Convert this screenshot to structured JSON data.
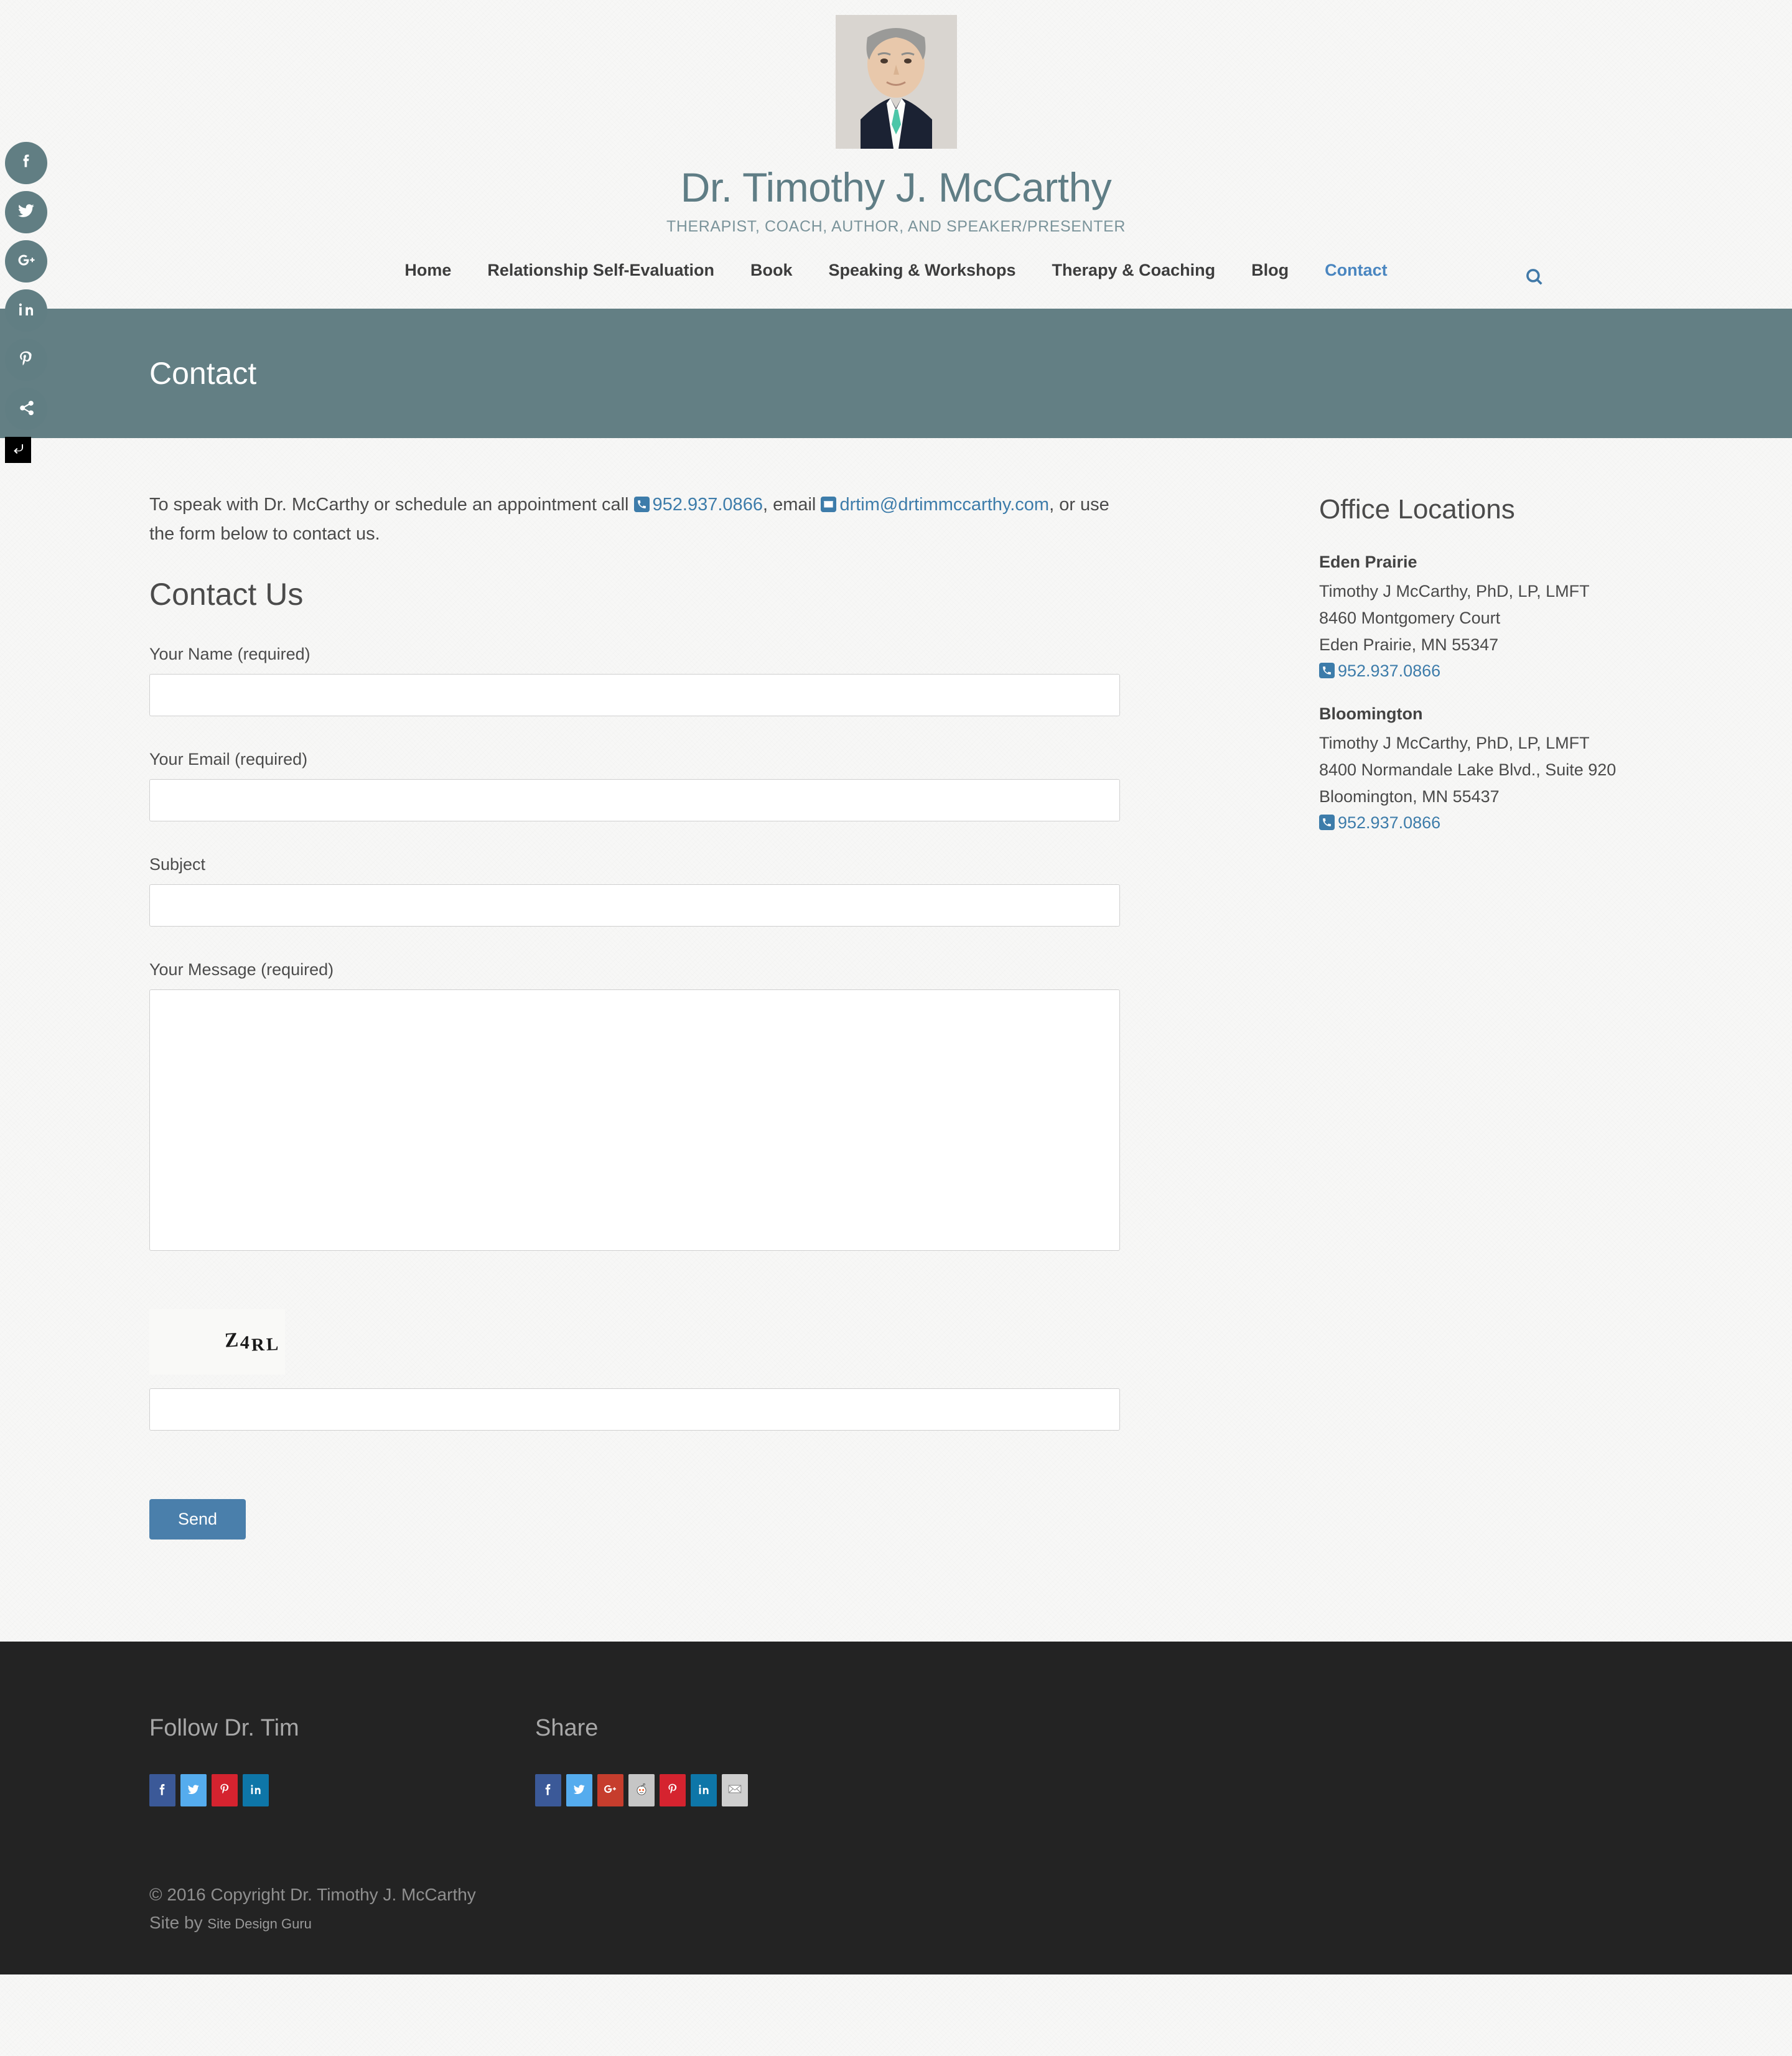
{
  "header": {
    "title": "Dr. Timothy J. McCarthy",
    "tagline": "THERAPIST, COACH, AUTHOR, AND SPEAKER/PRESENTER",
    "portrait_alt": "portrait-photo",
    "search_icon": "search-icon"
  },
  "nav": {
    "items": [
      {
        "label": "Home",
        "active": false
      },
      {
        "label": "Relationship Self-Evaluation",
        "active": false
      },
      {
        "label": "Book",
        "active": false
      },
      {
        "label": "Speaking & Workshops",
        "active": false
      },
      {
        "label": "Therapy & Coaching",
        "active": false
      },
      {
        "label": "Blog",
        "active": false
      },
      {
        "label": "Contact",
        "active": true
      }
    ]
  },
  "banner": {
    "title": "Contact"
  },
  "intro": {
    "before_phone": "To speak with Dr. McCarthy or schedule an appointment call ",
    "phone": "952.937.0866",
    "between": ", email ",
    "email": "drtim@drtimmccarthy.com",
    "after_email": ", or use the form below to contact us."
  },
  "form": {
    "heading": "Contact Us",
    "fields": [
      {
        "label": "Your Name (required)",
        "value": "",
        "type": "text",
        "name": "name"
      },
      {
        "label": "Your Email (required)",
        "value": "",
        "type": "text",
        "name": "email"
      },
      {
        "label": "Subject",
        "value": "",
        "type": "text",
        "name": "subject"
      }
    ],
    "message_label": "Your Message (required)",
    "message_value": "",
    "captcha_text": "Z4RL",
    "captcha_value": "",
    "send_label": "Send"
  },
  "sidebar": {
    "heading": "Office Locations",
    "offices": [
      {
        "name": "Eden Prairie",
        "line1": "Timothy J McCarthy, PhD, LP, LMFT",
        "line2": "8460 Montgomery Court",
        "line3": "Eden Prairie, MN 55347",
        "phone": "952.937.0866"
      },
      {
        "name": "Bloomington",
        "line1": "Timothy J McCarthy, PhD, LP, LMFT",
        "line2": "8400 Normandale Lake Blvd., Suite 920",
        "line3": "Bloomington, MN 55437",
        "phone": "952.937.0866"
      }
    ]
  },
  "social_rail": {
    "items": [
      "facebook-icon",
      "twitter-icon",
      "google-plus-icon",
      "linkedin-icon",
      "pinterest-icon",
      "share-icon"
    ],
    "collapse_icon": "collapse-arrow-icon"
  },
  "footer": {
    "follow_heading": "Follow Dr. Tim",
    "follow_icons": [
      "facebook-icon",
      "twitter-icon",
      "pinterest-icon",
      "linkedin-icon"
    ],
    "share_heading": "Share",
    "share_icons": [
      "facebook-icon",
      "twitter-icon",
      "google-plus-icon",
      "reddit-icon",
      "pinterest-icon",
      "linkedin-icon",
      "email-icon"
    ],
    "copyright": "© 2016 Copyright Dr. Timothy J. McCarthy",
    "site_by_prefix": "Site by ",
    "site_by_link": "Site Design Guru"
  },
  "colors": {
    "banner": "#637f84",
    "title": "#5f7d85",
    "link": "#3d7caa",
    "send_button": "#4a7fab",
    "footer_bg": "#232323",
    "rail": "#617e83"
  }
}
